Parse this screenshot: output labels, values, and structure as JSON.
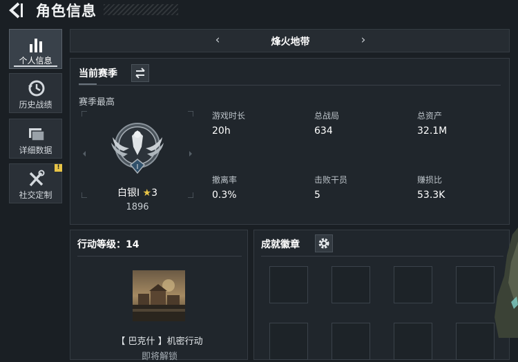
{
  "header": {
    "title": "角色信息"
  },
  "nav": {
    "items": [
      {
        "label": "个人信息",
        "icon": "bar-chart-icon",
        "active": true
      },
      {
        "label": "历史战绩",
        "icon": "history-clock-icon",
        "active": false
      },
      {
        "label": "详细数据",
        "icon": "folder-icon",
        "active": false
      },
      {
        "label": "社交定制",
        "icon": "tools-icon",
        "active": false,
        "badge": "!"
      }
    ]
  },
  "mode": {
    "title": "烽火地带",
    "prev": "‹",
    "next": "›"
  },
  "season": {
    "label": "当前赛季",
    "best_label": "赛季最高",
    "rank": {
      "name": "白银Ⅰ",
      "star": "★",
      "stars": "3",
      "score": "1896",
      "emblem_numeral": "I"
    },
    "stats": [
      {
        "label": "游戏时长",
        "value": "20h"
      },
      {
        "label": "总战局",
        "value": "634"
      },
      {
        "label": "总资产",
        "value": "32.1M"
      },
      {
        "label": "撤离率",
        "value": "0.3%"
      },
      {
        "label": "击败干员",
        "value": "5"
      },
      {
        "label": "赚损比",
        "value": "53.3K"
      }
    ]
  },
  "action": {
    "title": "行动等级：14",
    "mission_name": "【 巴克什 】机密行动",
    "mission_status": "即将解锁"
  },
  "achievements": {
    "title": "成就徽章",
    "slots": 8
  },
  "colors": {
    "accent_gold": "#e8c446",
    "panel_bg": "#20262c",
    "page_bg": "#1a1f24"
  }
}
